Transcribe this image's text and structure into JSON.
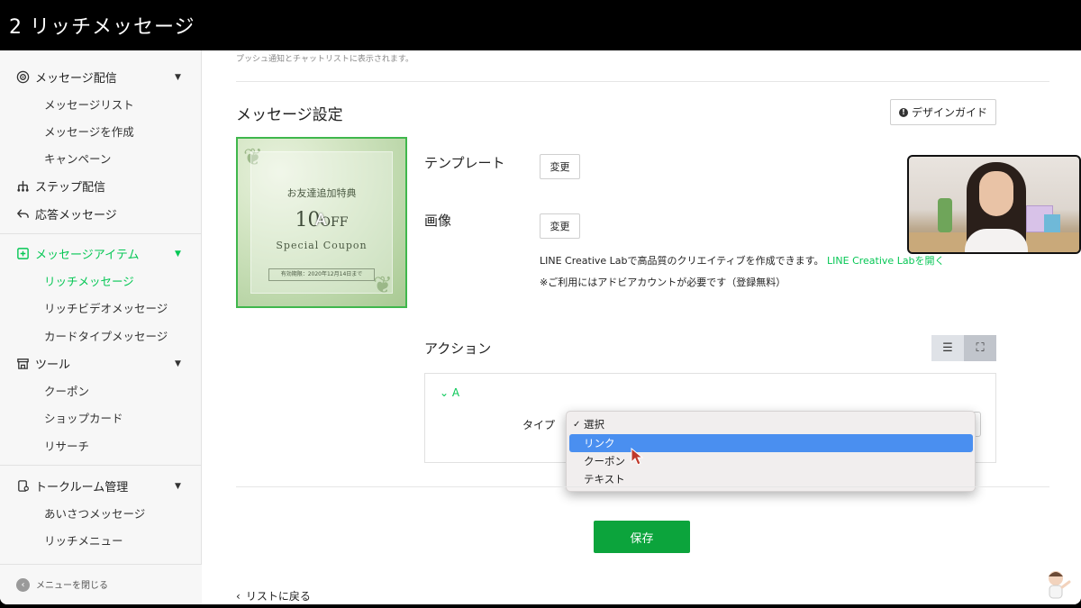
{
  "window": {
    "title": "2 リッチメッセージ"
  },
  "sidebar": {
    "sections": [
      {
        "label": "メッセージ配信",
        "icon": "broadcast-icon"
      },
      {
        "label": "ステップ配信",
        "icon": "step-icon"
      },
      {
        "label": "応答メッセージ",
        "icon": "reply-icon"
      },
      {
        "label": "メッセージアイテム",
        "icon": "add-box-icon"
      },
      {
        "label": "ツール",
        "icon": "store-icon"
      },
      {
        "label": "トークルーム管理",
        "icon": "chat-room-icon"
      }
    ],
    "items": {
      "message_list": "メッセージリスト",
      "create_message": "メッセージを作成",
      "campaign": "キャンペーン",
      "rich_message": "リッチメッセージ",
      "rich_video": "リッチビデオメッセージ",
      "card_type": "カードタイプメッセージ",
      "coupon": "クーポン",
      "shop_card": "ショップカード",
      "research": "リサーチ",
      "greeting": "あいさつメッセージ",
      "rich_menu": "リッチメニュー"
    },
    "footer": {
      "close_menu": "メニューを閉じる"
    }
  },
  "main": {
    "top_note": "プッシュ通知とチャットリストに表示されます。",
    "section_title": "メッセージ設定",
    "design_guide": "デザインガイド",
    "coupon_preview": {
      "line1": "お友達追加特典",
      "amount": "10",
      "off": "OFF",
      "line3": "Special Coupon",
      "expiry": "有効期限：2020年12月14日まで",
      "area_marker": "A"
    },
    "template_label": "テンプレート",
    "image_label": "画像",
    "change_label": "変更",
    "creative_lab_text": "LINE Creative Labで高品質のクリエイティブを作成できます。",
    "creative_lab_link": "LINE Creative Labを開く",
    "account_note": "※ご利用にはアドビアカウントが必要です（登録無料）",
    "action_label": "アクション",
    "action_area": "A",
    "type_label": "タイプ",
    "dropdown": {
      "options": [
        "選択",
        "リンク",
        "クーポン",
        "テキスト"
      ],
      "checked_index": 0,
      "highlighted_index": 1
    },
    "save": "保存",
    "back": "リストに戻る"
  },
  "colors": {
    "accent": "#06c755",
    "save": "#0ca43c",
    "highlight": "#4a8ff0"
  }
}
